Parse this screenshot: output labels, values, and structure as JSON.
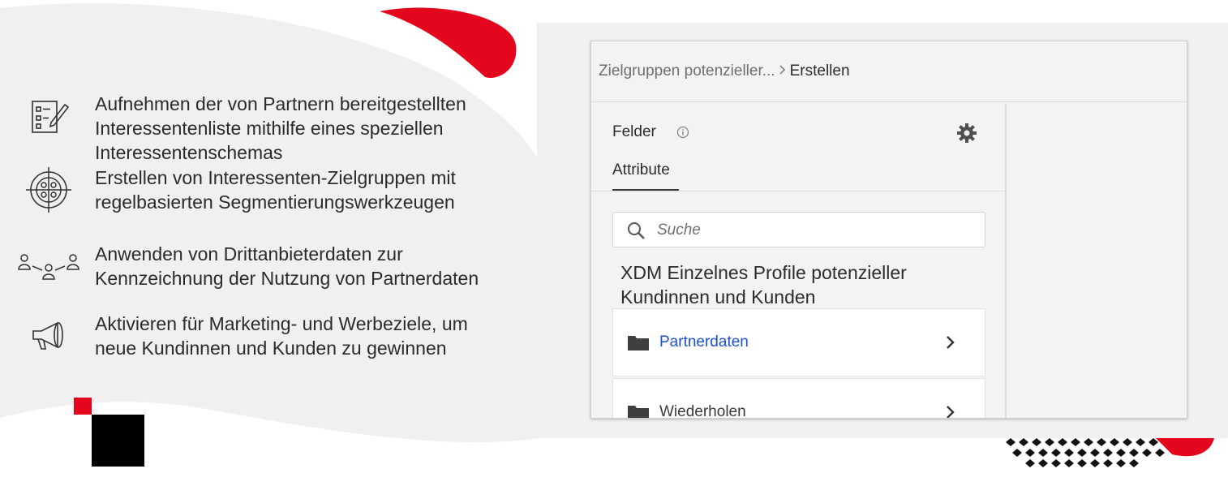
{
  "features": [
    {
      "icon": "checklist-pencil-icon",
      "text": "Aufnehmen der von Partnern bereitgestellten Interessentenliste mithilfe eines speziellen Interessentenschemas"
    },
    {
      "icon": "target-audience-icon",
      "text": "Erstellen von Interessenten-Zielgruppen mit regelbasierten Segmentierungswerkzeugen"
    },
    {
      "icon": "people-network-icon",
      "text": "Anwenden von Drittanbieterdaten zur Kennzeichnung der Nutzung von Partnerdaten"
    },
    {
      "icon": "megaphone-icon",
      "text": "Aktivieren für Marketing- und Werbeziele, um neue Kundinnen und Kunden zu gewinnen"
    }
  ],
  "breadcrumb": {
    "parent": "Zielgruppen potenzieller...",
    "separator": ">",
    "current": "Erstellen"
  },
  "fields_panel": {
    "title": "Felder",
    "tab": "Attribute",
    "search_placeholder": "Suche",
    "schema_title": "XDM Einzelnes Profile potenzieller Kundinnen und Kunden",
    "items": [
      {
        "label": "Partnerdaten",
        "color": "#1a4fd8"
      },
      {
        "label": "Wiederholen",
        "color": "#3a3a3a"
      }
    ]
  },
  "colors": {
    "accent_red": "#e3061c",
    "panel_bg": "#f3f3f3",
    "link_blue": "#1a4fd8"
  }
}
